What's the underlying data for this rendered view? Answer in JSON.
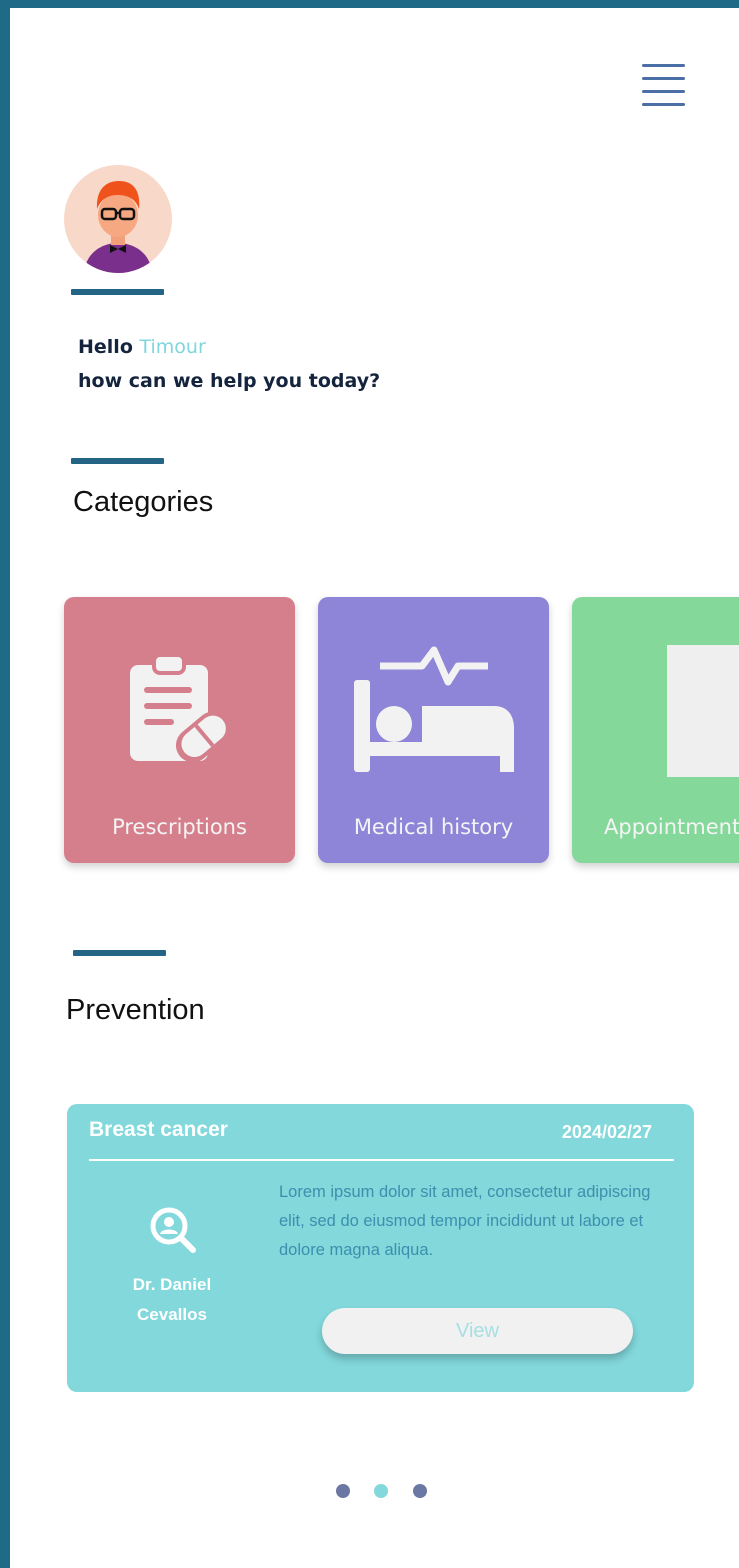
{
  "header": {
    "menu_icon": "hamburger-menu-icon"
  },
  "user": {
    "greeting_prefix": "Hello",
    "name": "Timour",
    "subtitle": "how can we help you today?",
    "avatar_icon": "user-avatar"
  },
  "sections": {
    "categories_title": "Categories",
    "prevention_title": "Prevention"
  },
  "categories": [
    {
      "label": "Prescriptions",
      "icon": "prescription-clipboard-icon",
      "color": "#d67f8c"
    },
    {
      "label": "Medical history",
      "icon": "hospital-bed-icon",
      "color": "#8e84d8"
    },
    {
      "label": "Appointments",
      "icon": "calendar-placeholder-icon",
      "color": "#84d89a"
    }
  ],
  "prevention_card": {
    "title": "Breast cancer",
    "date": "2024/02/27",
    "doctor_icon": "search-person-icon",
    "doctor_name": "Dr. Daniel Cevallos",
    "description": "Lorem ipsum dolor sit amet, consectetur adipiscing elit, sed do eiusmod tempor incididunt ut labore et dolore magna aliqua.",
    "button_label": "View",
    "color": "#82d8db"
  },
  "pagination": {
    "active_index": 1,
    "count": 3,
    "active_color": "#82d8db",
    "inactive_color": "#6b78a3"
  },
  "colors": {
    "frame": "#1f6a87",
    "accent": "#246586"
  }
}
